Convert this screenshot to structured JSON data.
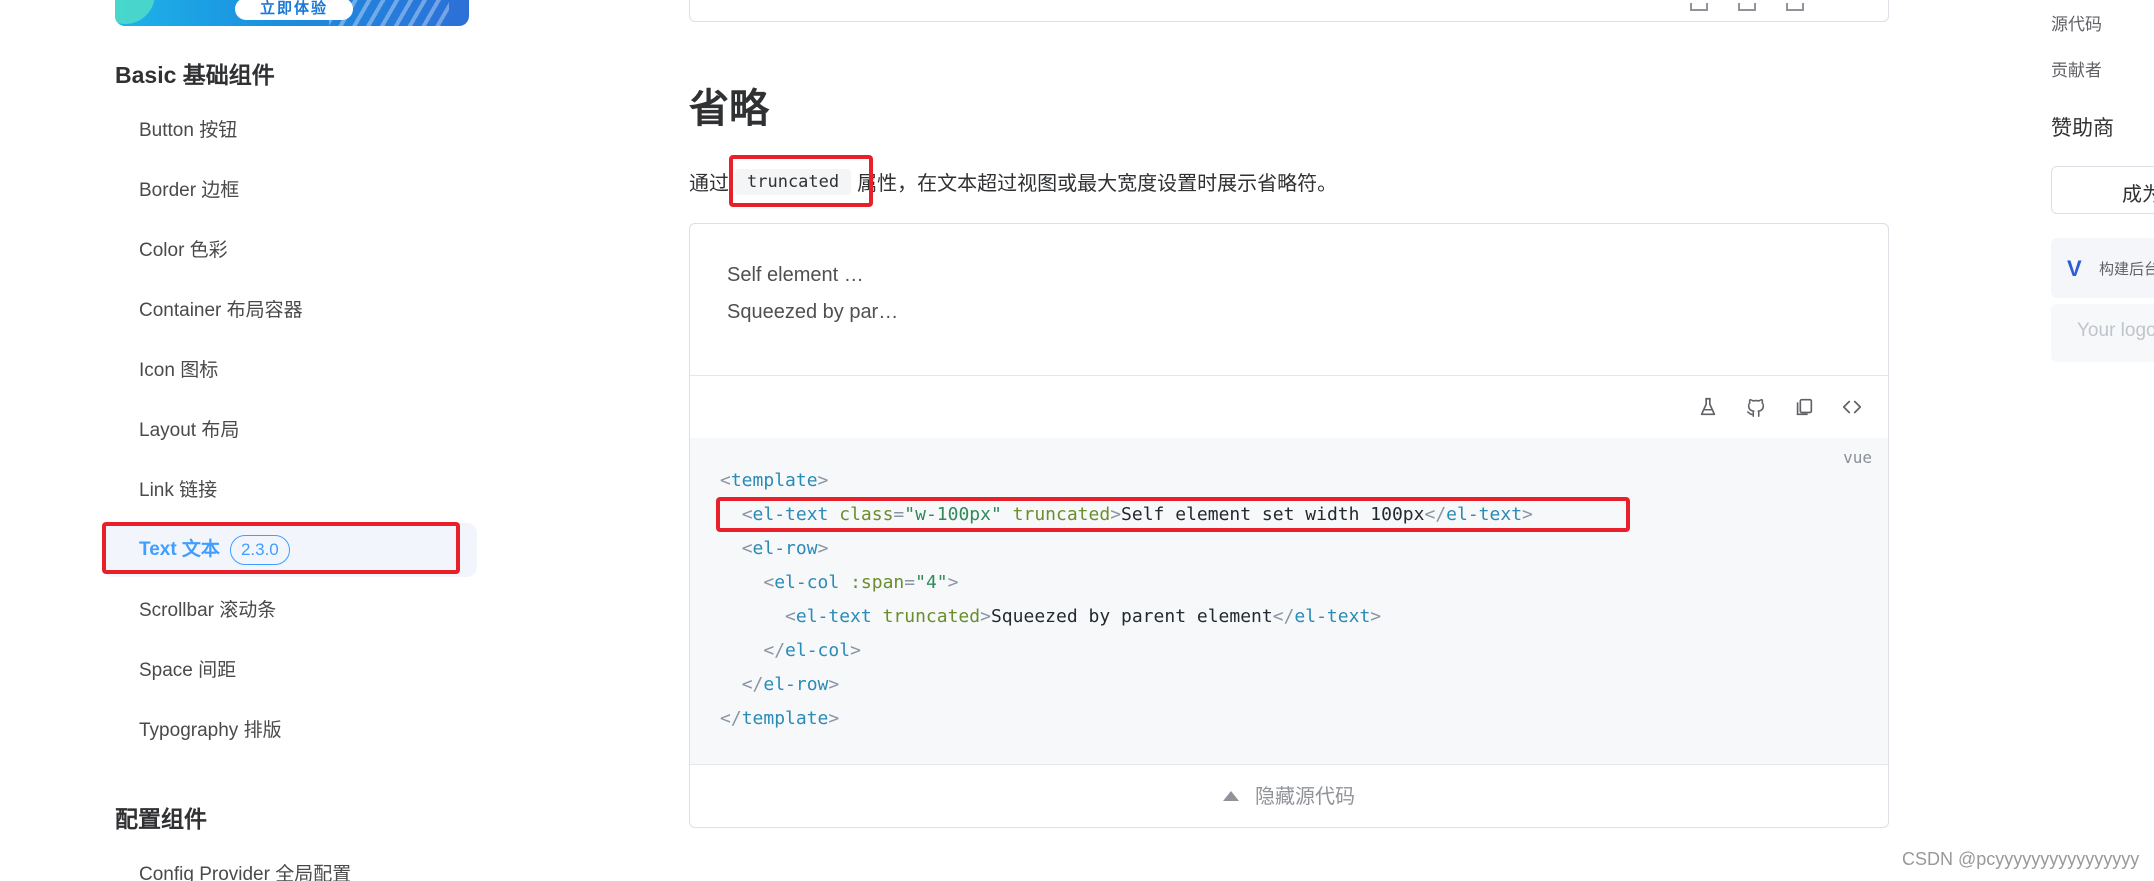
{
  "banner": {
    "button_label": "立即体验"
  },
  "sidebar": {
    "groups": [
      {
        "title": "Basic 基础组件"
      },
      {
        "title": "配置组件"
      }
    ],
    "items": [
      {
        "label": "Button 按钮"
      },
      {
        "label": "Border 边框"
      },
      {
        "label": "Color 色彩"
      },
      {
        "label": "Container 布局容器"
      },
      {
        "label": "Icon 图标"
      },
      {
        "label": "Layout 布局"
      },
      {
        "label": "Link 链接"
      },
      {
        "label": "Text 文本",
        "badge": "2.3.0",
        "active": true
      },
      {
        "label": "Scrollbar 滚动条"
      },
      {
        "label": "Space 间距"
      },
      {
        "label": "Typography 排版"
      },
      {
        "label": "Config Provider 全局配置"
      }
    ]
  },
  "main": {
    "section_title": "省略",
    "description": {
      "prefix": "通过",
      "code": "truncated",
      "suffix": "属性，在文本超过视图或最大宽度设置时展示省略符。"
    },
    "demo": {
      "preview_lines": [
        "Self element …",
        "Squeezed by par…"
      ],
      "toolbar_icons": [
        "flask-icon",
        "github-icon",
        "copy-icon",
        "code-icon"
      ],
      "lang": "vue",
      "code": {
        "line1_tag": "template",
        "line2_tag": "el-text",
        "line2_attr_class": "class",
        "line2_attr_class_value": "\"w-100px\"",
        "line2_attr_truncated": "truncated",
        "line2_text": "Self element set width 100px",
        "line3_tag": "el-row",
        "line4_tag": "el-col",
        "line4_attr": ":span",
        "line4_attr_value": "\"4\"",
        "line5_tag": "el-text",
        "line5_attr": "truncated",
        "line5_text": "Squeezed by parent element",
        "line6_tag": "el-col",
        "line7_tag": "el-row",
        "line8_tag": "template"
      },
      "toggle_label": "隐藏源代码"
    }
  },
  "aside": {
    "links": [
      "源代码",
      "贡献者"
    ],
    "sponsor_title": "赞助商",
    "sponsor_button": "成为",
    "sponsor_card_text": "构建后台",
    "sponsor_slot": "Your logo"
  },
  "watermark": "CSDN @pcyyyyyyyyyyyyyyyy",
  "colors": {
    "accent": "#409eff",
    "highlight_box": "#e8202a"
  }
}
